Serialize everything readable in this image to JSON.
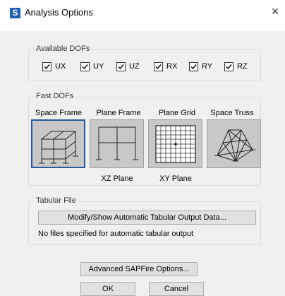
{
  "window": {
    "app_icon_letter": "S",
    "title": "Analysis Options",
    "close_glyph": "×"
  },
  "available_dofs": {
    "title": "Available DOFs",
    "items": [
      {
        "label": "UX",
        "checked": true
      },
      {
        "label": "UY",
        "checked": true
      },
      {
        "label": "UZ",
        "checked": true
      },
      {
        "label": "RX",
        "checked": true
      },
      {
        "label": "RY",
        "checked": true
      },
      {
        "label": "RZ",
        "checked": true
      }
    ]
  },
  "fast_dofs": {
    "title": "Fast DOFs",
    "options": [
      {
        "label": "Space Frame",
        "plane": "",
        "selected": true,
        "icon": "space-frame-icon"
      },
      {
        "label": "Plane Frame",
        "plane": "XZ Plane",
        "selected": false,
        "icon": "plane-frame-icon"
      },
      {
        "label": "Plane Grid",
        "plane": "XY Plane",
        "selected": false,
        "icon": "plane-grid-icon"
      },
      {
        "label": "Space Truss",
        "plane": "",
        "selected": false,
        "icon": "space-truss-icon"
      }
    ]
  },
  "tabular_file": {
    "title": "Tabular File",
    "button": "Modify/Show Automatic Tabular Output Data...",
    "note": "No files specified for automatic tabular output"
  },
  "buttons": {
    "advanced": "Advanced SAPFire Options...",
    "ok": "OK",
    "cancel": "Cancel"
  },
  "colors": {
    "selection_border": "#2a5a9f",
    "tile_bg": "#c8c8c8",
    "app_icon_bg": "#1e5fae"
  }
}
